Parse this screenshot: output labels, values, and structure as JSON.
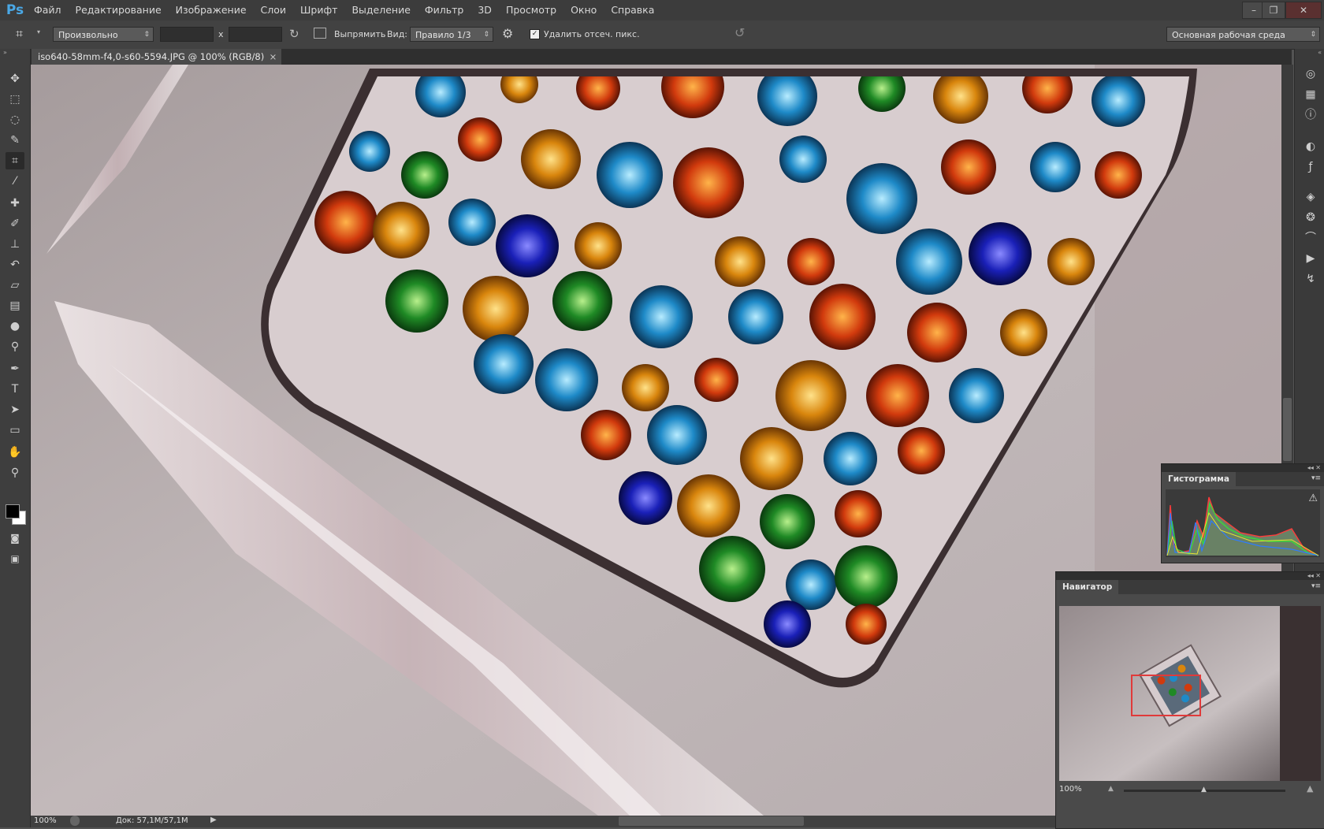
{
  "app": {
    "logo": "Ps"
  },
  "menu": [
    "Файл",
    "Редактирование",
    "Изображение",
    "Слои",
    "Шрифт",
    "Выделение",
    "Фильтр",
    "3D",
    "Просмотр",
    "Окно",
    "Справка"
  ],
  "window_controls": {
    "minimize": "–",
    "restore": "❐",
    "close": "✕"
  },
  "options": {
    "ratio_select": "Произвольно",
    "x_separator": "x",
    "straighten_label": "Выпрямить",
    "view_label": "Вид:",
    "view_select": "Правило 1/3",
    "delete_cropped_label": "Удалить отсеч. пикс.",
    "delete_cropped_checked": true,
    "workspace_select": "Основная рабочая среда"
  },
  "document": {
    "tab_title": "iso640-58mm-f4,0-s60-5594.JPG @ 100% (RGB/8)",
    "tab_close": "×"
  },
  "tools": [
    {
      "name": "move-tool",
      "icon": "✥"
    },
    {
      "name": "marquee-tool",
      "icon": "⬚"
    },
    {
      "name": "lasso-tool",
      "icon": "◌"
    },
    {
      "name": "quick-selection-tool",
      "icon": "✎"
    },
    {
      "name": "crop-tool",
      "icon": "⌗",
      "active": true
    },
    {
      "name": "eyedropper-tool",
      "icon": "⁄"
    },
    {
      "name": "healing-brush-tool",
      "icon": "✚"
    },
    {
      "name": "brush-tool",
      "icon": "✐"
    },
    {
      "name": "clone-stamp-tool",
      "icon": "⊥"
    },
    {
      "name": "history-brush-tool",
      "icon": "↶"
    },
    {
      "name": "eraser-tool",
      "icon": "▱"
    },
    {
      "name": "gradient-tool",
      "icon": "▤"
    },
    {
      "name": "blur-tool",
      "icon": "●"
    },
    {
      "name": "dodge-tool",
      "icon": "⚲"
    },
    {
      "name": "pen-tool",
      "icon": "✒"
    },
    {
      "name": "type-tool",
      "icon": "T"
    },
    {
      "name": "path-selection-tool",
      "icon": "➤"
    },
    {
      "name": "rectangle-tool",
      "icon": "▭"
    },
    {
      "name": "hand-tool",
      "icon": "✋"
    },
    {
      "name": "zoom-tool",
      "icon": "⚲"
    }
  ],
  "status": {
    "zoom": "100%",
    "doc_info": "Док: 57,1M/57,1M"
  },
  "panels": {
    "histogram": {
      "title": "Гистограмма",
      "warning": "⚠"
    },
    "navigator": {
      "title": "Навигатор",
      "zoom": "100%"
    }
  },
  "right_icons": [
    "palette-icon",
    "swatches-icon",
    "info-icon",
    "adjustments-icon",
    "styles-icon",
    "layers-icon",
    "channels-icon",
    "paths-icon",
    "actions-icon",
    "history-icon"
  ],
  "colors": {
    "accent": "#4aa8e6",
    "nav_box": "#e03a3a"
  }
}
